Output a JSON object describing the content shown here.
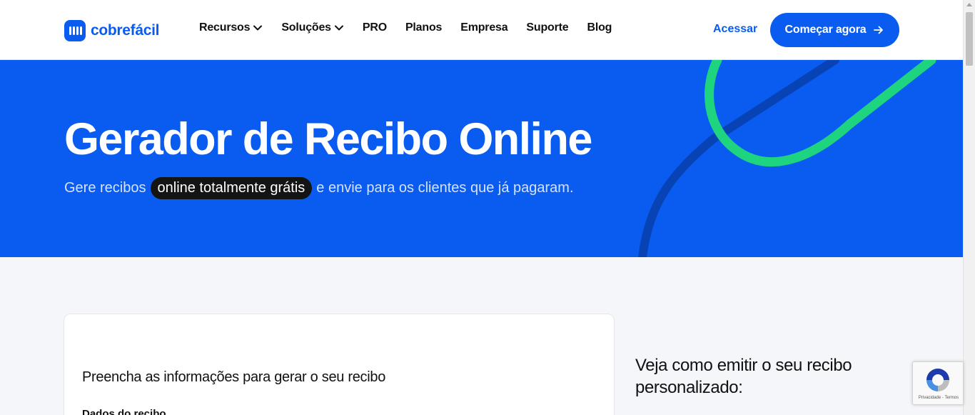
{
  "brand": {
    "name": "cobrefácil",
    "color": "#0a5cf0"
  },
  "nav": {
    "items": [
      {
        "label": "Recursos",
        "dropdown": true
      },
      {
        "label": "Soluções",
        "dropdown": true
      },
      {
        "label": "PRO",
        "dropdown": false
      },
      {
        "label": "Planos",
        "dropdown": false
      },
      {
        "label": "Empresa",
        "dropdown": false
      },
      {
        "label": "Suporte",
        "dropdown": false
      },
      {
        "label": "Blog",
        "dropdown": false
      }
    ],
    "login_label": "Acessar",
    "cta_label": "Começar agora",
    "cta_icon": "arrow-right-icon"
  },
  "hero": {
    "title": "Gerador de Recibo Online",
    "subtitle_before": "Gere recibos",
    "subtitle_highlight": "online totalmente grátis",
    "subtitle_after": "e envie para os clientes que já pagaram.",
    "background": "#0a5cf0",
    "accent_green": "#1ed47f"
  },
  "form": {
    "title": "Preencha as informações para gerar o seu recibo",
    "section_label": "Dados do recibo"
  },
  "sidebar": {
    "title": "Veja como emitir o seu recibo personalizado:"
  },
  "recaptcha": {
    "text": "Privacidade - Termos",
    "icon": "recaptcha-icon"
  }
}
